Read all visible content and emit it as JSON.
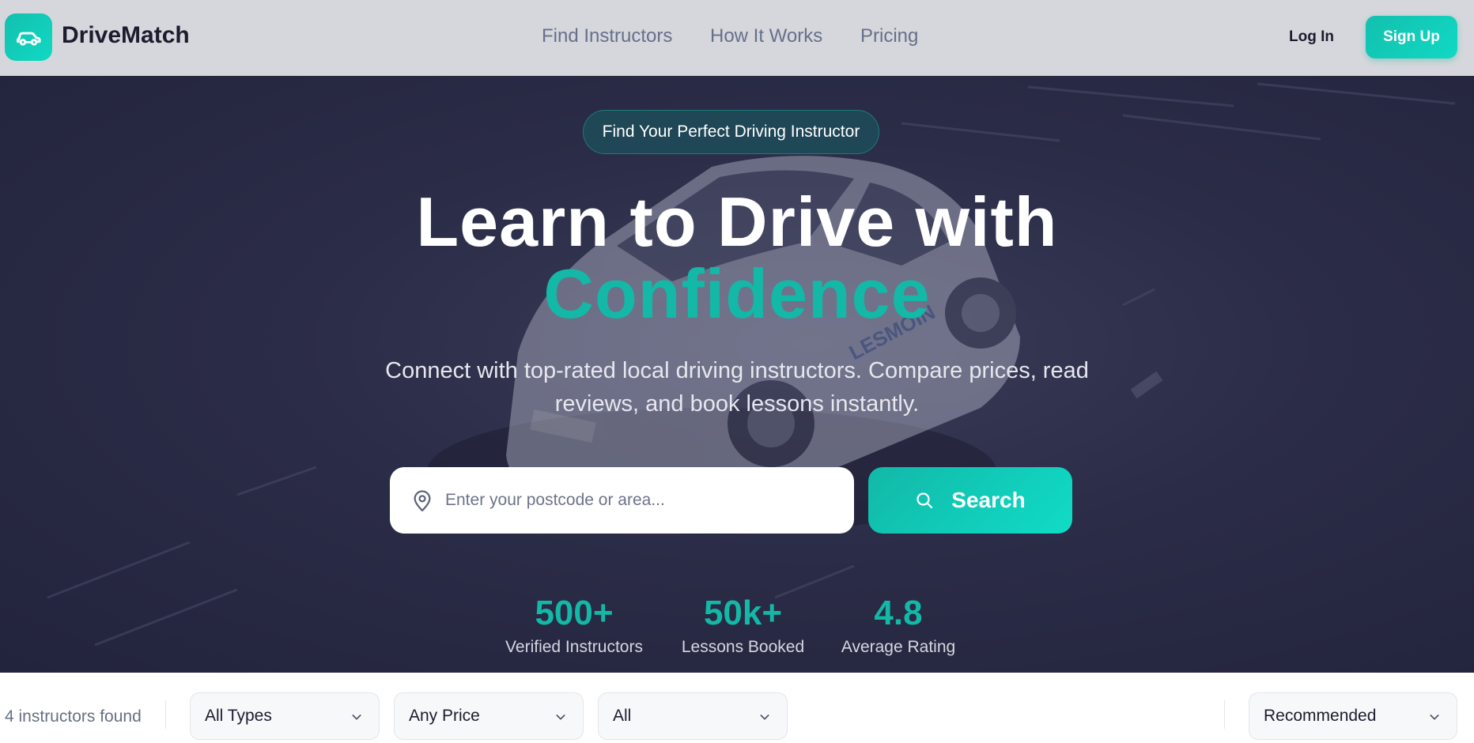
{
  "header": {
    "brand": "DriveMatch",
    "nav": [
      "Find Instructors",
      "How It Works",
      "Pricing"
    ],
    "login_label": "Log In",
    "signup_label": "Sign Up"
  },
  "hero": {
    "badge": "Find Your Perfect Driving Instructor",
    "title_line1": "Learn to Drive with",
    "title_line2": "Confidence",
    "subtitle": "Connect with top-rated local driving instructors. Compare prices, read reviews, and book lessons instantly.",
    "search": {
      "placeholder": "Enter your postcode or area...",
      "button_label": "Search"
    },
    "stats": [
      {
        "value": "500+",
        "label": "Verified Instructors"
      },
      {
        "value": "50k+",
        "label": "Lessons Booked"
      },
      {
        "value": "4.8",
        "label": "Average Rating"
      }
    ],
    "background_car_text": "LESMOIN"
  },
  "filters": {
    "count_text": "4 instructors found",
    "selects": [
      "All Types",
      "Any Price",
      "All"
    ],
    "sort": "Recommended"
  },
  "colors": {
    "accent": "#13b8a6",
    "header_bg": "#d6d7dc",
    "hero_bg": "#2b2c47",
    "text_dark": "#1b1d2e"
  },
  "icons": [
    "car-icon",
    "map-pin-icon",
    "search-icon",
    "chevron-down-icon"
  ]
}
